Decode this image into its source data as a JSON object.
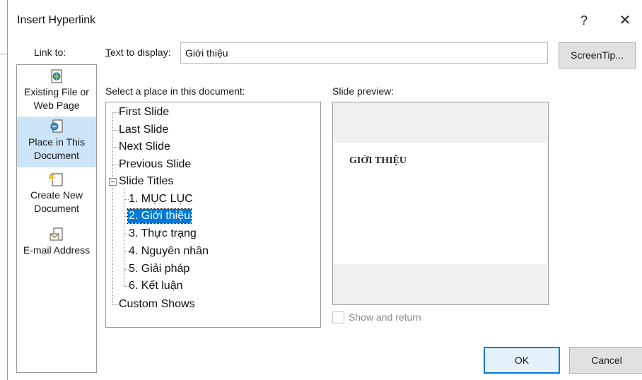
{
  "window": {
    "title": "Insert Hyperlink",
    "help_label": "?",
    "close_label": "✕"
  },
  "link_to": {
    "label": "Link to:",
    "items": [
      {
        "line1": "Existing File or",
        "line2": "Web Page",
        "icon": "existing-file-icon",
        "selected": false
      },
      {
        "line1": "Place in This",
        "line2": "Document",
        "icon": "place-in-document-icon",
        "selected": true
      },
      {
        "line1": "Create New",
        "line2": "Document",
        "icon": "create-new-document-icon",
        "selected": false
      },
      {
        "line1": "E-mail Address",
        "line2": "",
        "icon": "email-address-icon",
        "selected": false
      }
    ]
  },
  "text_to_display": {
    "label_prefix": "T",
    "label_rest": "ext to display:",
    "value": "Giới thiệu"
  },
  "screentip_label": "ScreenTip...",
  "place_label": "Select a place in this document:",
  "tree": {
    "items": [
      "First Slide",
      "Last Slide",
      "Next Slide",
      "Previous Slide",
      "Slide Titles",
      "1. MỤC LỤC",
      "2. Giới thiệu",
      "3. Thực trạng",
      "4. Nguyên nhân",
      "5. Giải pháp",
      "6. Kết luận",
      "Custom Shows"
    ],
    "selected": "2. Giới thiệu"
  },
  "preview": {
    "label": "Slide preview:",
    "slide_title": "GIỚI THIỆU"
  },
  "show_and_return": {
    "label": "Show and return",
    "checked": false
  },
  "buttons": {
    "ok": "OK",
    "cancel": "Cancel"
  },
  "colors": {
    "selection": "#0078d7",
    "linkbar_selected": "#cce4f7",
    "button_face": "#e1e1e1"
  }
}
